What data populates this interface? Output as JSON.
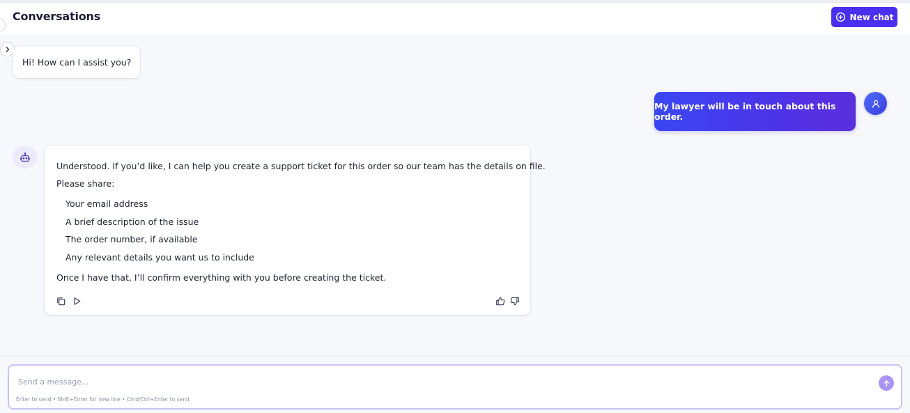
{
  "header": {
    "title": "Conversations",
    "new_chat_label": "New chat"
  },
  "messages": {
    "greeting": "Hi! How can I assist you?",
    "user_message": "My lawyer will be in touch about this order.",
    "bot_reply": {
      "intro": "Understood. If you’d like, I can help you create a support ticket for this order so our team has the details on file.",
      "prompt": "Please share:",
      "items": [
        "Your email address",
        "A brief description of the issue",
        "The order number, if available",
        "Any relevant details you want us to include"
      ],
      "closing": "Once I have that, I’ll confirm everything with you before creating the ticket."
    }
  },
  "composer": {
    "placeholder": "Send a message...",
    "hint": "Enter to send • Shift+Enter for new line • Cmd/Ctrl+Enter to send"
  },
  "icons": {
    "new_chat": "plus-circle-icon",
    "expand": "chevron-right-icon",
    "user_avatar": "user-icon",
    "bot_avatar": "robot-icon",
    "copy": "copy-icon",
    "play": "play-icon",
    "thumbs_up": "thumbs-up-icon",
    "thumbs_down": "thumbs-down-icon",
    "send": "arrow-up-icon"
  },
  "colors": {
    "accent": "#4a2ff0",
    "user_bubble_start": "#3a47f2",
    "user_bubble_end": "#5b2fdc",
    "send_button": "#a993f5",
    "composer_border": "#c9c2f4"
  }
}
